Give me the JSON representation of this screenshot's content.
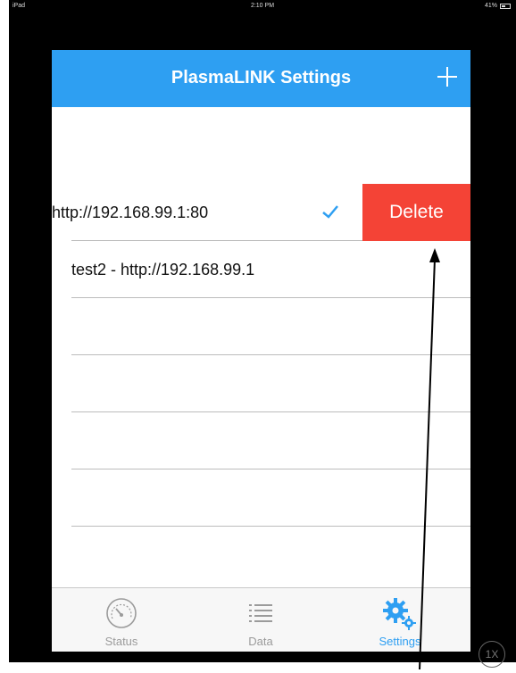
{
  "status_bar": {
    "device": "iPad",
    "time": "2:10 PM",
    "battery": "41%"
  },
  "navbar": {
    "title": "PlasmaLINK Settings",
    "add_icon": "plus-icon"
  },
  "list": {
    "rows": [
      {
        "label": "http://192.168.99.1:80",
        "selected": true,
        "delete_label": "Delete"
      },
      {
        "label": "test2 - http://192.168.99.1"
      },
      {
        "label": ""
      },
      {
        "label": ""
      },
      {
        "label": ""
      },
      {
        "label": ""
      }
    ]
  },
  "tabbar": {
    "tabs": [
      {
        "label": "Status",
        "icon": "gauge-icon",
        "active": false
      },
      {
        "label": "Data",
        "icon": "list-icon",
        "active": false
      },
      {
        "label": "Settings",
        "icon": "gear-icon",
        "active": true
      }
    ]
  },
  "overlay": {
    "zoom_label": "1X"
  },
  "colors": {
    "accent": "#2e9ff2",
    "delete": "#f44336",
    "frame": "#000000"
  }
}
